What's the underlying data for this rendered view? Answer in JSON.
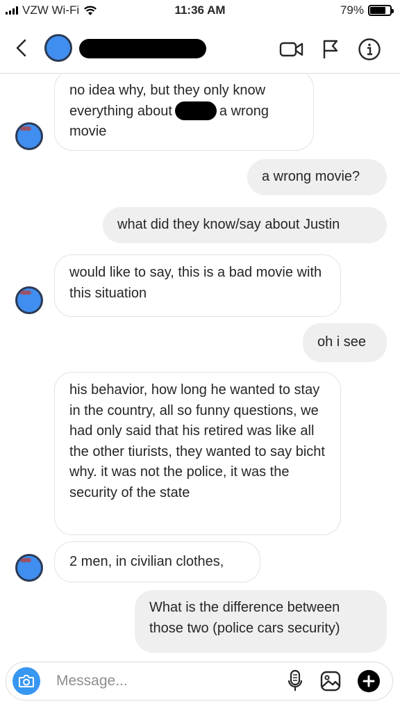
{
  "status_bar": {
    "carrier": "VZW Wi-Fi",
    "time": "11:36 AM",
    "battery_percent": "79%"
  },
  "header": {
    "icons": [
      "back-icon",
      "video-call-icon",
      "flag-icon",
      "info-icon"
    ]
  },
  "messages": [
    {
      "side": "incoming",
      "text_before": "no idea why, but they only know everything about",
      "text_after": "a wrong movie"
    },
    {
      "side": "outgoing",
      "text": "a wrong movie?"
    },
    {
      "side": "outgoing",
      "text": "what did they know/say about Justin"
    },
    {
      "side": "incoming",
      "text": "would like to say, this is a bad movie with this situation"
    },
    {
      "side": "outgoing",
      "text": "oh i see"
    },
    {
      "side": "incoming",
      "text": "his behavior, how long he wanted to stay in the country, all so funny questions, we had only said that his retired was like all the other tiurists, they wanted to say bicht why. it was not the police, it was the security of the state"
    },
    {
      "side": "incoming",
      "text": "2 men, in civilian clothes,"
    },
    {
      "side": "outgoing",
      "text": "What is the difference between those two (police cars security)"
    }
  ],
  "composer": {
    "placeholder": "Message...",
    "icons": [
      "camera-icon",
      "microphone-icon",
      "gallery-icon",
      "plus-icon"
    ]
  },
  "colors": {
    "accent": "#3897f0",
    "outgoing_bubble": "#efefef",
    "incoming_border": "#e2e2e2"
  }
}
